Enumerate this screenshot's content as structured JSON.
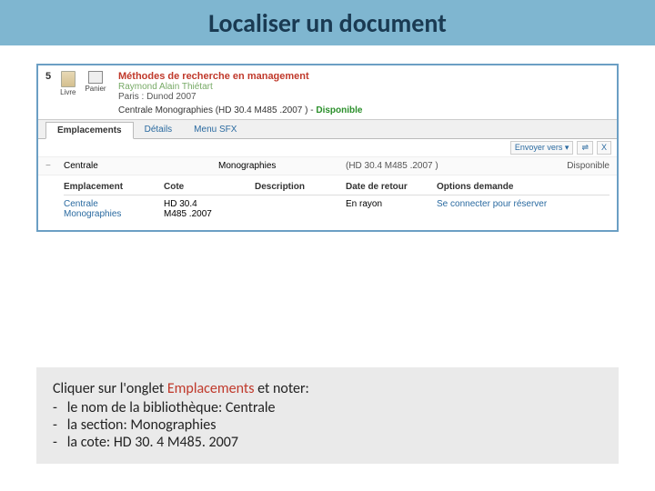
{
  "title": "Localiser un document",
  "result": {
    "number": "5",
    "book_label": "Livre",
    "cart_label": "Panier",
    "title": "Méthodes de recherche en management",
    "author": "Raymond Alain Thiétart",
    "publisher": "Paris : Dunod 2007",
    "holdings_prefix": "Centrale Monographies (HD 30.4 M485 .2007 ) - ",
    "availability": "Disponible"
  },
  "tabs": {
    "emplacements": "Emplacements",
    "details": "Détails",
    "menu": "Menu SFX"
  },
  "send": {
    "envoyer": "Envoyer vers",
    "arrow": "▾",
    "rss": "⇌",
    "close": "X"
  },
  "loc_header": {
    "toggle": "−",
    "lib": "Centrale",
    "section": "Monographies",
    "call": "(HD 30.4 M485 .2007 )",
    "status": "Disponible"
  },
  "table": {
    "headers": {
      "emplacement": "Emplacement",
      "cote": "Cote",
      "description": "Description",
      "date": "Date de retour",
      "options": "Options demande"
    },
    "row": {
      "emplacement_line1": "Centrale",
      "emplacement_line2": "Monographies",
      "cote_line1": "HD 30.4",
      "cote_line2": "M485 .2007",
      "description": "",
      "date": "En rayon",
      "options": "Se connecter pour réserver"
    }
  },
  "instruction": {
    "line1_a": "Cliquer sur l'onglet ",
    "line1_b": "Emplacements",
    "line1_c": " et noter:",
    "b1": "le nom de la bibliothèque: Centrale",
    "b2": "la section:  Monographies",
    "b3": "la cote: HD 30. 4 M485. 2007"
  }
}
